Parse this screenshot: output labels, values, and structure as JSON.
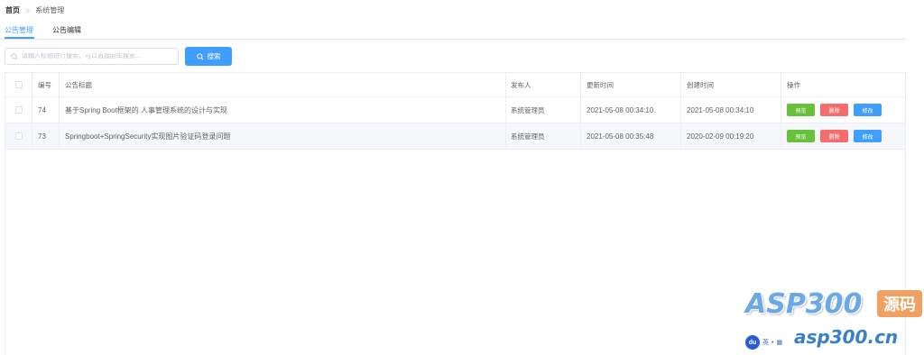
{
  "breadcrumb": {
    "home": "首页",
    "separator": ">",
    "current": "系统管理"
  },
  "tabs": [
    {
      "label": "公告管理",
      "active": true
    },
    {
      "label": "公告编辑",
      "active": false
    }
  ],
  "search": {
    "placeholder": "请输入标题进行搜索，可以直接回车搜索...",
    "value": "",
    "button_label": "搜索"
  },
  "table": {
    "columns": [
      "",
      "编号",
      "公告标题",
      "发布人",
      "更新时间",
      "创建时间",
      "操作"
    ],
    "rows": [
      {
        "id": "74",
        "title": "基于Spring Boot框架的 人事管理系统的设计与实现",
        "publisher": "系统管理员",
        "updated": "2021-05-08 00:34:10",
        "created": "2021-05-08 00:34:10"
      },
      {
        "id": "73",
        "title": "Springboot+SpringSecurity实现图片验证码登录问题",
        "publisher": "系统管理员",
        "updated": "2021-05-08 00:35:48",
        "created": "2020-02-09 00:19:20"
      }
    ],
    "actions": {
      "preview": "预览",
      "delete": "删除",
      "edit": "修改"
    }
  },
  "watermark": {
    "brand": "ASP300",
    "tag": "源码",
    "url": "asp300.cn",
    "ime_logo": "du",
    "ime_lang": "英"
  },
  "colors": {
    "primary": "#409eff",
    "success": "#67c23a",
    "danger": "#f56c6c",
    "border": "#ebeef5"
  }
}
